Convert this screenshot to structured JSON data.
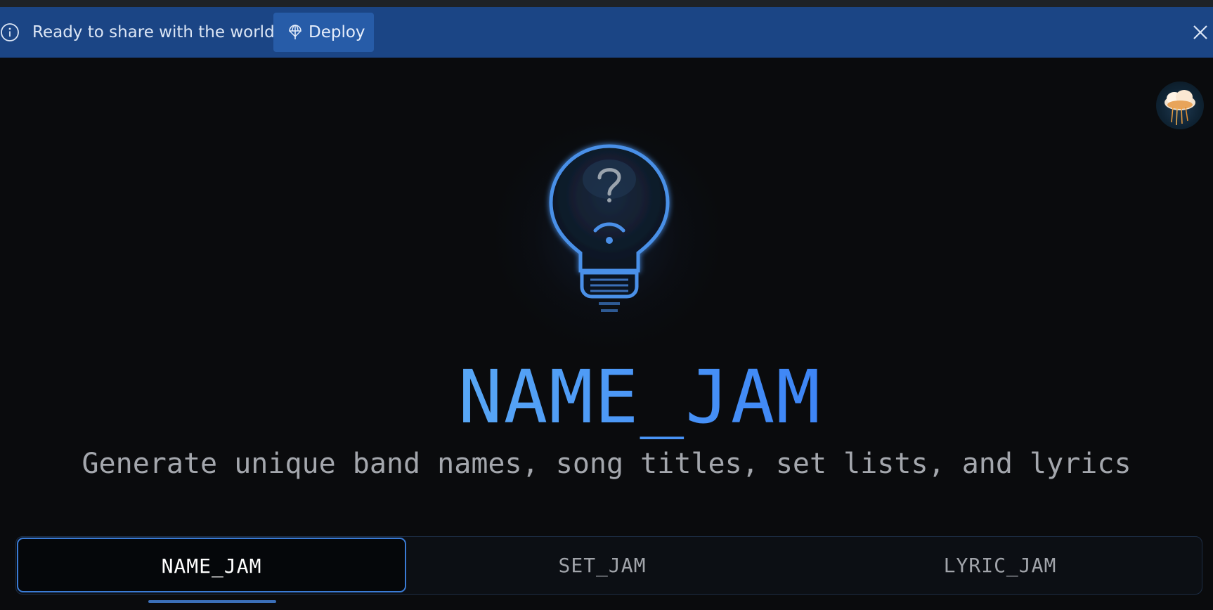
{
  "banner": {
    "message": "Ready to share with the world?",
    "deploy_label": "Deploy",
    "info_icon": "info-icon",
    "deploy_icon": "deploy-icon",
    "close_icon": "close-icon",
    "background": "#1b4585"
  },
  "app": {
    "title": "NAME_JAM",
    "subtitle": "Generate unique band names, song titles, set lists, and lyrics",
    "logo_icon": "lightbulb-question-icon",
    "accent": "#3b82f6"
  },
  "tabs": {
    "items": [
      {
        "label": "NAME_JAM",
        "active": true
      },
      {
        "label": "SET_JAM",
        "active": false
      },
      {
        "label": "LYRIC_JAM",
        "active": false
      }
    ]
  },
  "user": {
    "avatar_icon": "avatar-cloud-image"
  }
}
